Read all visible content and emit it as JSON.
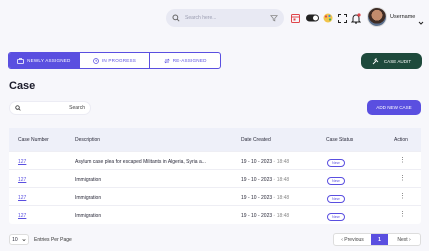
{
  "topbar": {
    "search_placeholder": "Search here...",
    "username": "Username"
  },
  "tabs": [
    {
      "label": "Newly Assigned",
      "icon": "briefcase-icon",
      "active": true
    },
    {
      "label": "In Progress",
      "icon": "clock-icon",
      "active": false
    },
    {
      "label": "Re-Assigned",
      "icon": "reassign-icon",
      "active": false
    }
  ],
  "case_audit_label": "Case Audit",
  "page_title": "Case",
  "search_label": "Search",
  "add_new_case_label": "Add New Case",
  "table": {
    "headers": [
      "Case Number",
      "Description",
      "Date Created",
      "Case Status",
      "Action"
    ],
    "rows": [
      {
        "case_number": "127",
        "description": "Asylum case plea for escaped Militants in Algeria, Syria a...",
        "date": "19 - 10 - 2023",
        "time": "18:48",
        "status": "New"
      },
      {
        "case_number": "127",
        "description": "Immigration",
        "date": "19 - 10 - 2023",
        "time": "18:48",
        "status": "New"
      },
      {
        "case_number": "127",
        "description": "Immigration",
        "date": "19 - 10 - 2023",
        "time": "18:48",
        "status": "New"
      },
      {
        "case_number": "127",
        "description": "Immigration",
        "date": "19 - 10 - 2023",
        "time": "18:48",
        "status": "New"
      }
    ]
  },
  "footer": {
    "entries_value": "10",
    "entries_label": "Entries Per Page",
    "prev_label": "Previous",
    "current_page": "1",
    "next_label": "Next"
  },
  "colors": {
    "accent": "#5a4fe0",
    "audit_button": "#1e4a3c",
    "background": "#f7f7fb"
  }
}
